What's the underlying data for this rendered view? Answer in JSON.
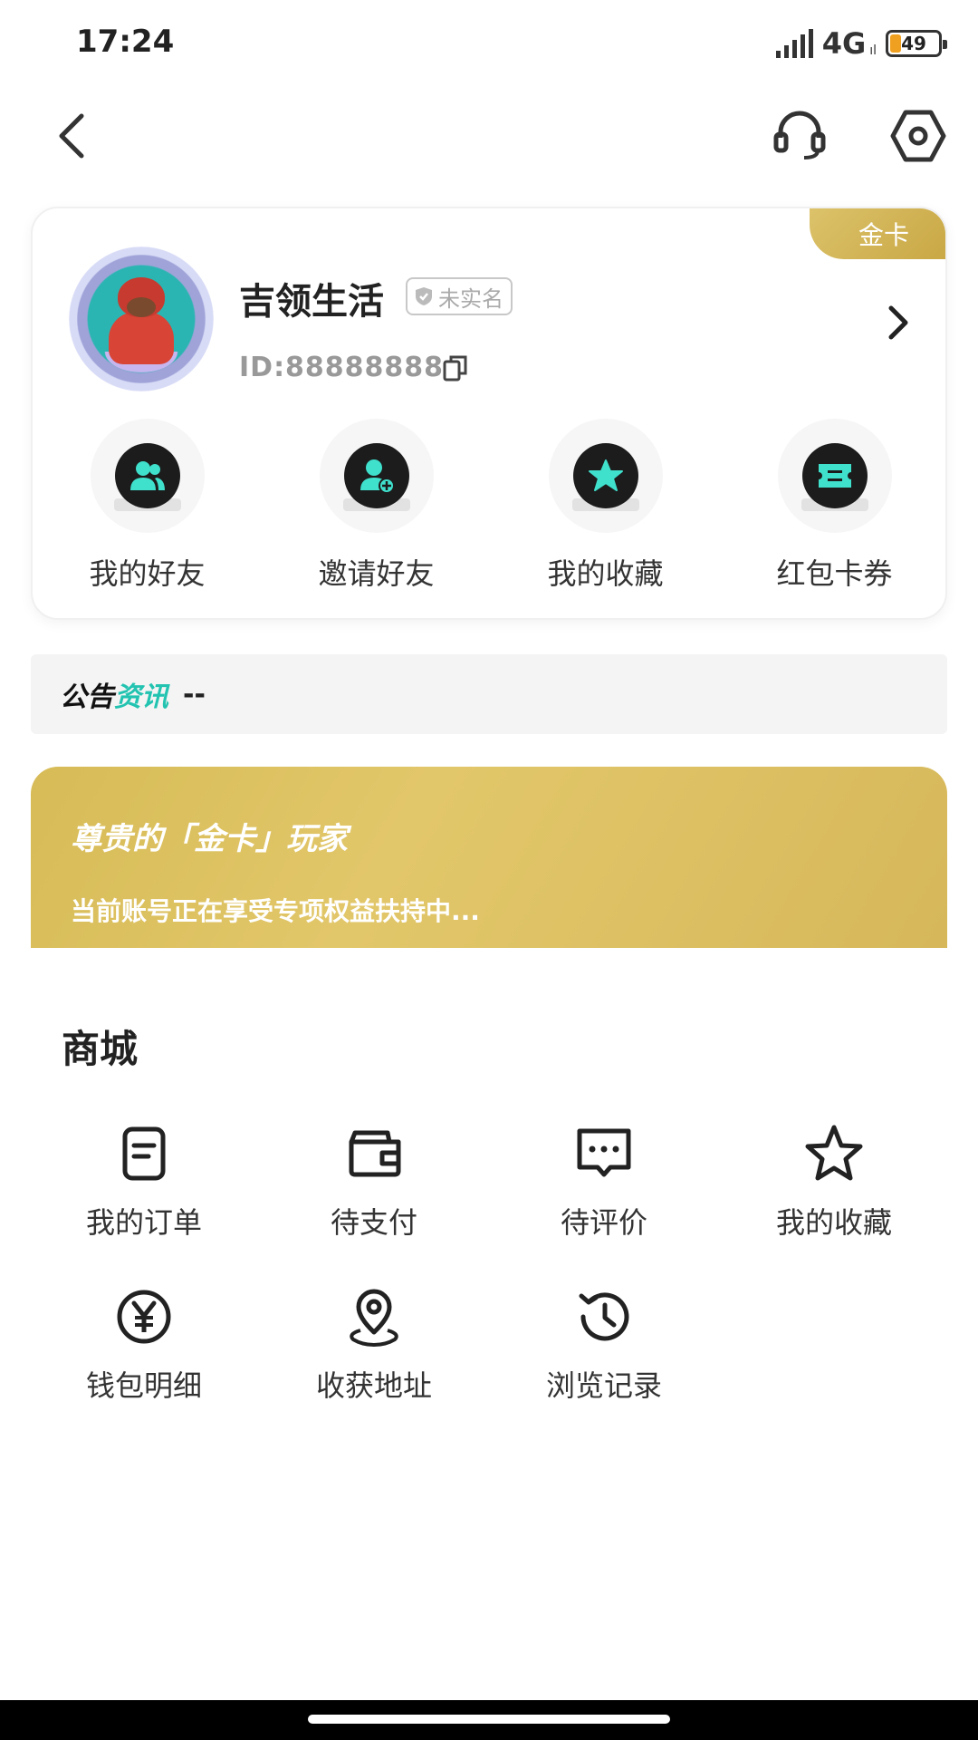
{
  "status_bar": {
    "time": "17:24",
    "network": "4G",
    "network_sub": "ıl",
    "battery": "49"
  },
  "nav": {
    "back_icon": "chevron-left-icon",
    "service_icon": "headset-icon",
    "settings_icon": "hexagon-gear-icon"
  },
  "profile": {
    "tier_badge": "金卡",
    "username": "吉领生活",
    "verify_status": "未实名",
    "user_id": "ID:88888888",
    "quick_actions": [
      {
        "label": "我的好友",
        "icon": "friends-icon"
      },
      {
        "label": "邀请好友",
        "icon": "add-friend-icon"
      },
      {
        "label": "我的收藏",
        "icon": "star-icon"
      },
      {
        "label": "红包卡券",
        "icon": "coupon-icon"
      }
    ]
  },
  "notice": {
    "label_a": "公告",
    "label_b": "资讯",
    "text": "--"
  },
  "gold_banner": {
    "title": "尊贵的「金卡」玩家",
    "subtitle": "当前账号正在享受专项权益扶持中..."
  },
  "mall": {
    "title": "商城",
    "items": [
      {
        "label": "我的订单",
        "icon": "order-icon"
      },
      {
        "label": "待支付",
        "icon": "wallet-icon"
      },
      {
        "label": "待评价",
        "icon": "comment-icon"
      },
      {
        "label": "我的收藏",
        "icon": "star-outline-icon"
      },
      {
        "label": "钱包明细",
        "icon": "yen-icon"
      },
      {
        "label": "收获地址",
        "icon": "location-icon"
      },
      {
        "label": "浏览记录",
        "icon": "history-icon"
      }
    ]
  },
  "colors": {
    "accent": "#22c3b0",
    "gold": "#d7bb57",
    "dark": "#1c1c1c"
  }
}
